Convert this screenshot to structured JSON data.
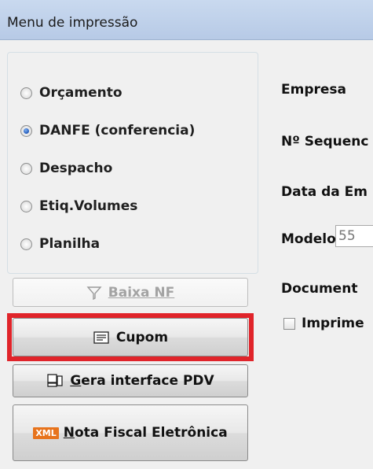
{
  "window": {
    "title": "Menu de impressão"
  },
  "print_options": {
    "items": [
      {
        "label": "Orçamento",
        "selected": false
      },
      {
        "label": "DANFE (conferencia)",
        "selected": true
      },
      {
        "label": "Despacho",
        "selected": false
      },
      {
        "label": "Etiq.Volumes",
        "selected": false
      },
      {
        "label": "Planilha",
        "selected": false
      }
    ]
  },
  "actions": {
    "baixa_nf": {
      "label": "Baixa NF",
      "enabled": false,
      "icon": "funnel-icon"
    },
    "cupom": {
      "label": "Cupom",
      "icon": "receipt-printer-icon",
      "highlighted": true
    },
    "gera_interface_pdv": {
      "label_underline": "G",
      "label_rest": "era interface PDV",
      "icon": "pdv-terminal-icon"
    },
    "nota_fiscal": {
      "badge": "XML",
      "label_underline": "N",
      "label_rest": "ota Fiscal Eletrônica"
    }
  },
  "form": {
    "empresa_label": "Empresa",
    "sequencia_label": "Nº Sequenc",
    "data_label": "Data da Em",
    "modelo_label": "Modelo",
    "modelo_value": "55",
    "documento_label": "Document",
    "imprime_label": "Imprime"
  },
  "colors": {
    "highlight": "#e0242a",
    "xml_badge": "#e7731c",
    "radio_selected": "#1f57b8"
  }
}
